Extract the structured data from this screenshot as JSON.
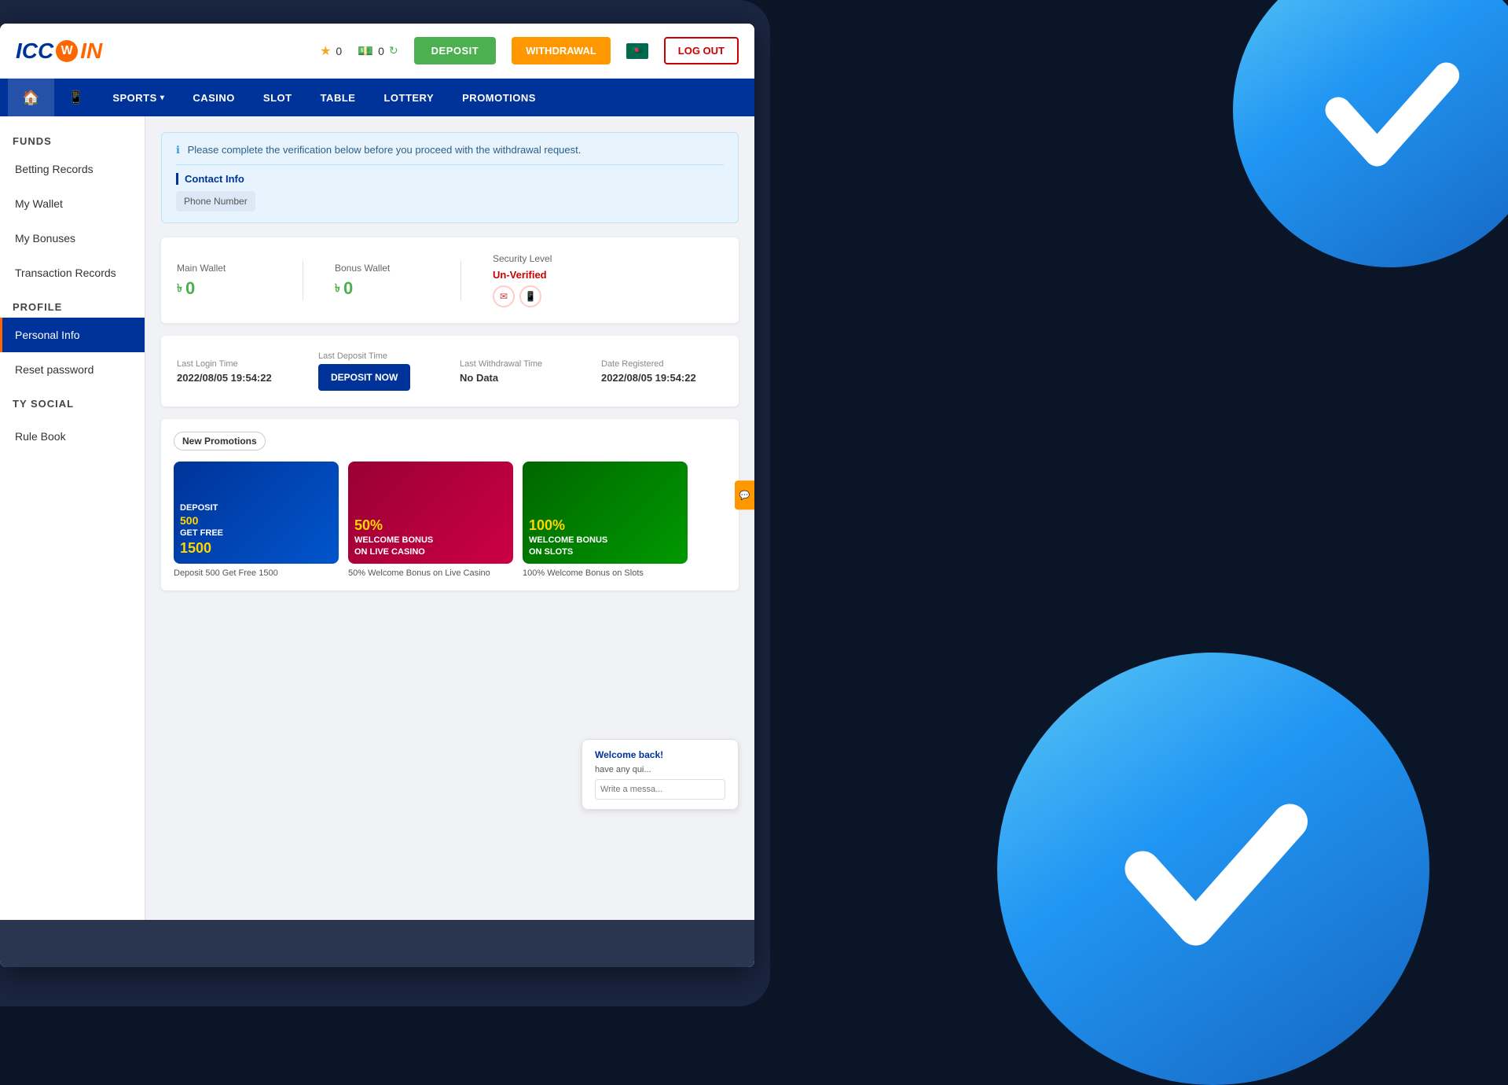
{
  "brand": {
    "icc": "ICC",
    "win": "WIN",
    "logo_circle_letter": "W"
  },
  "header": {
    "points_star": "0",
    "points_money": "0",
    "deposit_label": "DEPOSIT",
    "withdrawal_label": "WITHDRAWAL",
    "logout_label": "LOG OUT"
  },
  "navbar": {
    "home_icon": "🏠",
    "mobile_icon": "📱",
    "sports": "SPORTS",
    "casino": "CASINO",
    "slot": "SLOT",
    "table": "TABLE",
    "lottery": "LOTTERY",
    "promotions": "PROMOTIONS"
  },
  "sidebar": {
    "funds_title": "FUNDS",
    "betting_records": "Betting Records",
    "my_wallet": "My Wallet",
    "my_bonuses": "My Bonuses",
    "transaction_records": "Transaction Records",
    "profile_title": "PROFILE",
    "personal_info": "Personal Info",
    "reset_password": "Reset password",
    "ty_social_title": "TY SOCIAL",
    "rule_book": "Rule Book"
  },
  "notice": {
    "message": "Please complete the verification below before you proceed with the withdrawal request.",
    "contact_info_label": "Contact Info",
    "phone_number_label": "Phone Number"
  },
  "wallet": {
    "main_wallet_label": "Main Wallet",
    "main_wallet_value": "0",
    "bonus_wallet_label": "Bonus Wallet",
    "bonus_wallet_value": "0",
    "security_level_label": "Security Level",
    "security_status": "Un-Verified"
  },
  "login_info": {
    "last_login_label": "Last Login Time",
    "last_login_value": "2022/08/05 19:54:22",
    "last_deposit_label": "Last Deposit Time",
    "deposit_now_btn": "DEPOSIT NOW",
    "last_withdrawal_label": "Last Withdrawal Time",
    "last_withdrawal_value": "No Data",
    "date_registered_label": "Date Registered",
    "date_registered_value": "2022/08/05 19:54:22"
  },
  "promotions": {
    "badge": "New Promotions",
    "cards": [
      {
        "title": "DEPOSIT 500 GET FREE 1500",
        "label": "Deposit 500 Get Free 1500"
      },
      {
        "title": "50% WELCOME BONUS ON LIVE CASINO",
        "label": "50% Welcome Bonus on Live Casino"
      },
      {
        "title": "100% WELCOME BONUS ON SLOTS",
        "label": "100% Welcome Bonus on Slots"
      }
    ]
  },
  "chat": {
    "title": "Welcome back!",
    "subtitle": "have any qui...",
    "input_placeholder": "Write a messa..."
  }
}
